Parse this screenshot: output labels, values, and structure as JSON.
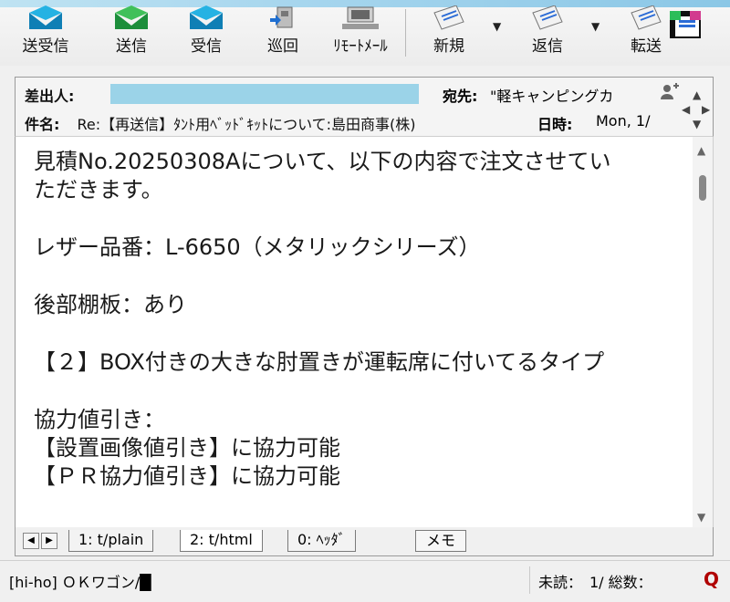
{
  "toolbar": {
    "buttons": [
      {
        "label": "送受信",
        "icon": "send-receive-icon"
      },
      {
        "label": "送信",
        "icon": "send-icon"
      },
      {
        "label": "受信",
        "icon": "receive-icon"
      },
      {
        "label": "巡回",
        "icon": "patrol-icon"
      },
      {
        "label": "ﾘﾓｰﾄﾒｰﾙ",
        "icon": "remote-mail-icon"
      },
      {
        "label": "新規",
        "icon": "new-mail-icon"
      },
      {
        "label": "返信",
        "icon": "reply-icon"
      },
      {
        "label": "転送",
        "icon": "forward-icon"
      }
    ]
  },
  "header": {
    "from_label": "差出人:",
    "to_label": "宛先:",
    "to_value": "\"軽キャンピングカ",
    "subject_label": "件名:",
    "subject_value": "Re:【再送信】ﾀﾝﾄ用ﾍﾞｯﾄﾞｷｯﾄについて:島田商事(株)",
    "date_label": "日時:",
    "date_value": "Mon, 1/"
  },
  "body": {
    "paragraphs": [
      "見積No.20250308Aについて、以下の内容で注文させてい",
      "ただきます。",
      "",
      "レザー品番：L-6650（メタリックシリーズ）",
      "",
      "後部棚板：あり",
      "",
      "【２】BOX付きの大きな肘置きが運転席に付いてるタイプ",
      "",
      "協力値引き：",
      "【設置画像値引き】に協力可能",
      "【ＰＲ協力値引き】に協力可能"
    ]
  },
  "tabs": {
    "items": [
      {
        "label": "1: t/plain"
      },
      {
        "label": "2: t/html"
      },
      {
        "label": "0: ﾍｯﾀﾞ"
      }
    ],
    "memo_label": "メモ"
  },
  "status": {
    "left": "[hi-ho] ＯＫワゴン/█",
    "right": "未読：　1/ 総数：",
    "q": "Q"
  }
}
